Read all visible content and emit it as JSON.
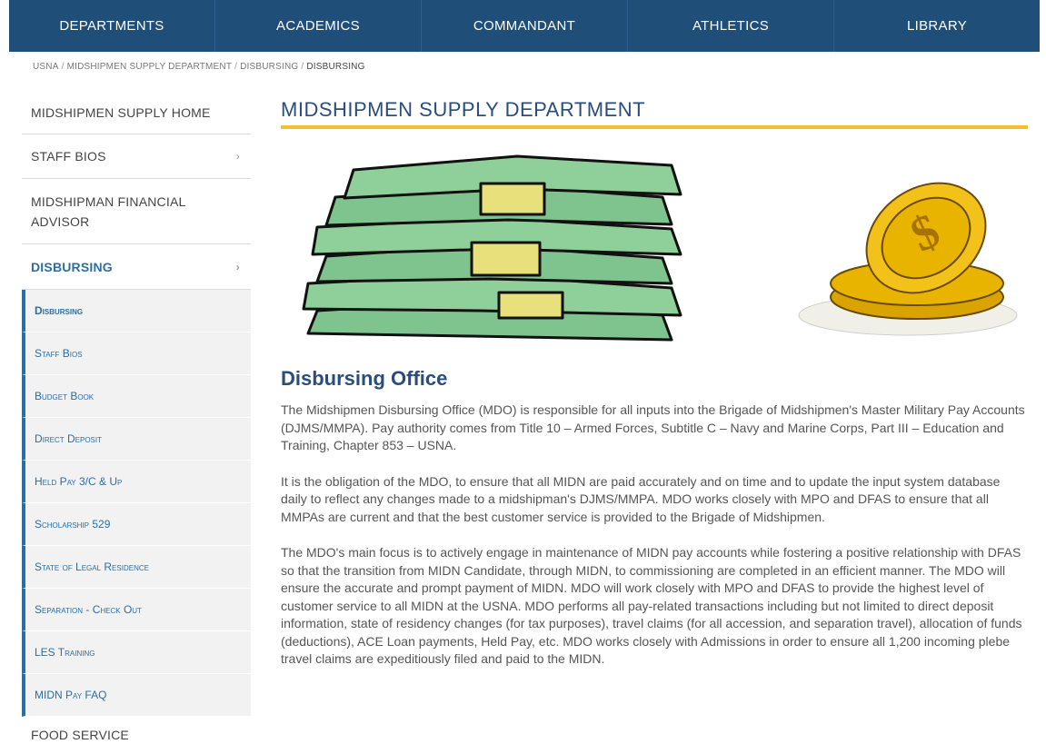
{
  "topnav": {
    "items": [
      "DEPARTMENTS",
      "ACADEMICS",
      "COMMANDANT",
      "ATHLETICS",
      "LIBRARY"
    ]
  },
  "breadcrumb": [
    "USNA",
    "MIDSHIPMEN SUPPLY DEPARTMENT",
    "DISBURSING",
    "DISBURSING"
  ],
  "sidebar": {
    "home": "MIDSHIPMEN SUPPLY HOME",
    "bios": "STAFF BIOS",
    "advisor": "MIDSHIPMAN FINANCIAL ADVISOR",
    "disbursing": "DISBURSING",
    "sub_items": [
      "Disbursing",
      "Staff Bios",
      "Budget Book",
      "Direct Deposit",
      "Held Pay 3/C & Up",
      "Scholarship 529",
      "State of Legal Residence",
      "Separation - Check Out",
      "LES Training",
      "MIDN Pay FAQ"
    ],
    "food": "FOOD SERVICE",
    "chevron": "›"
  },
  "main": {
    "title": "MIDSHIPMEN SUPPLY DEPARTMENT",
    "section_title": "Disbursing Office",
    "paragraphs": [
      "The Midshipmen Disbursing Office (MDO) is responsible for all inputs into the Brigade of Midshipmen's Master Military Pay Accounts (DJMS/MMPA).  Pay authority comes from Title 10 – Armed Forces, Subtitle C – Navy and Marine Corps, Part III – Education and Training, Chapter 853 – USNA.",
      "It is the obligation of the MDO, to ensure that all MIDN are paid accurately and on time and to update the input system database daily to reflect any changes made to a midshipman's DJMS/MMPA. MDO works closely with MPO and DFAS to ensure that all MMPAs are current and that the best customer service is provided to the Brigade of Midshipmen.",
      "The MDO's main focus is to actively engage in maintenance of MIDN pay accounts while fostering a positive relationship with DFAS so that the transition from MIDN Candidate, through MIDN, to commissioning are completed in an efficient manner.  The MDO will ensure the accurate and prompt payment of MIDN.  MDO will work closely with MPO and DFAS to provide the highest level of customer service to all MIDN at the USNA. MDO performs all pay-related transactions including but not limited to direct deposit information, state of residency changes (for tax purposes), travel claims (for all accession, and separation travel), allocation of funds (deductions), ACE Loan payments, Held Pay, etc.  MDO works closely with Admissions in order to ensure all 1,200 incoming plebe travel claims are expeditiously filed and paid to the MIDN."
    ]
  },
  "colors": {
    "nav_bg": "#1f4e79",
    "accent": "#2c6da4",
    "title": "#2a4d7d",
    "rule": "#f0c030",
    "money_green": "#7fc48f",
    "band_yellow": "#e8e07a",
    "coin_gold": "#e8b400"
  },
  "icons": [
    "money-stack-icon",
    "gold-coins-icon",
    "chevron-right-icon"
  ]
}
